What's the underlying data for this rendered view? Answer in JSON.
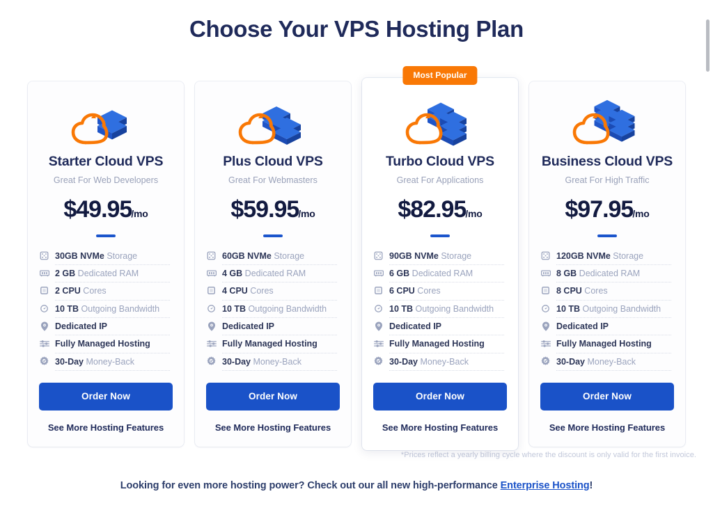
{
  "header": {
    "title": "Choose Your VPS Hosting Plan"
  },
  "colors": {
    "accent_blue": "#1a52c8",
    "badge_orange": "#f97805",
    "title_navy": "#1f2a5a",
    "muted_gray": "#9aa3bd"
  },
  "badge": {
    "label": "Most Popular"
  },
  "cta": {
    "order_label": "Order Now",
    "more_features_label": "See More Hosting Features"
  },
  "footnote": {
    "text": "*Prices reflect a yearly billing cycle where the discount is only valid for the first invoice."
  },
  "bottom_banner": {
    "text_before": "Looking for even more hosting power? Check out our all new high-performance ",
    "link_label": "Enterprise Hosting",
    "text_after": "!"
  },
  "plans": [
    {
      "name": "Starter Cloud VPS",
      "tagline": "Great For Web Developers",
      "price_amount": "$49.95",
      "price_period": "/mo",
      "featured": false,
      "icon": "cloud-server-single-icon",
      "icon_stacks": 1,
      "features": [
        {
          "icon": "storage-icon",
          "strong": "30GB NVMe",
          "light": " Storage",
          "underline": true
        },
        {
          "icon": "ram-icon",
          "strong": "2 GB",
          "light": " Dedicated RAM",
          "underline": true
        },
        {
          "icon": "cpu-icon",
          "strong": "2 CPU",
          "light": " Cores",
          "underline": true
        },
        {
          "icon": "gauge-icon",
          "strong": "10 TB",
          "light": " Outgoing Bandwidth",
          "underline": true
        },
        {
          "icon": "location-icon",
          "strong": "Dedicated IP",
          "light": "",
          "underline": true
        },
        {
          "icon": "sliders-icon",
          "strong": "Fully Managed Hosting",
          "light": "",
          "underline": true
        },
        {
          "icon": "shield-gear-icon",
          "strong": "30-Day",
          "light": " Money-Back",
          "underline": true
        }
      ]
    },
    {
      "name": "Plus Cloud VPS",
      "tagline": "Great For Webmasters",
      "price_amount": "$59.95",
      "price_period": "/mo",
      "featured": false,
      "icon": "cloud-server-double-icon",
      "icon_stacks": 2,
      "features": [
        {
          "icon": "storage-icon",
          "strong": "60GB NVMe",
          "light": " Storage",
          "underline": true
        },
        {
          "icon": "ram-icon",
          "strong": "4 GB",
          "light": " Dedicated RAM",
          "underline": true
        },
        {
          "icon": "cpu-icon",
          "strong": "4 CPU",
          "light": " Cores",
          "underline": true
        },
        {
          "icon": "gauge-icon",
          "strong": "10 TB",
          "light": " Outgoing Bandwidth",
          "underline": true
        },
        {
          "icon": "location-icon",
          "strong": "Dedicated IP",
          "light": "",
          "underline": true
        },
        {
          "icon": "sliders-icon",
          "strong": "Fully Managed Hosting",
          "light": "",
          "underline": true
        },
        {
          "icon": "shield-gear-icon",
          "strong": "30-Day",
          "light": " Money-Back",
          "underline": true
        }
      ]
    },
    {
      "name": "Turbo Cloud VPS",
      "tagline": "Great For Applications",
      "price_amount": "$82.95",
      "price_period": "/mo",
      "featured": true,
      "icon": "cloud-server-triple-icon",
      "icon_stacks": 3,
      "features": [
        {
          "icon": "storage-icon",
          "strong": "90GB NVMe",
          "light": " Storage",
          "underline": true
        },
        {
          "icon": "ram-icon",
          "strong": "6 GB",
          "light": " Dedicated RAM",
          "underline": true
        },
        {
          "icon": "cpu-icon",
          "strong": "6 CPU",
          "light": " Cores",
          "underline": true
        },
        {
          "icon": "gauge-icon",
          "strong": "10 TB",
          "light": " Outgoing Bandwidth",
          "underline": true
        },
        {
          "icon": "location-icon",
          "strong": "Dedicated IP",
          "light": "",
          "underline": true
        },
        {
          "icon": "sliders-icon",
          "strong": "Fully Managed Hosting",
          "light": "",
          "underline": true
        },
        {
          "icon": "shield-gear-icon",
          "strong": "30-Day",
          "light": " Money-Back",
          "underline": true
        }
      ]
    },
    {
      "name": "Business Cloud VPS",
      "tagline": "Great For High Traffic",
      "price_amount": "$97.95",
      "price_period": "/mo",
      "featured": false,
      "icon": "cloud-server-quad-icon",
      "icon_stacks": 4,
      "features": [
        {
          "icon": "storage-icon",
          "strong": "120GB NVMe",
          "light": " Storage",
          "underline": true
        },
        {
          "icon": "ram-icon",
          "strong": "8 GB",
          "light": " Dedicated RAM",
          "underline": true
        },
        {
          "icon": "cpu-icon",
          "strong": "8 CPU",
          "light": " Cores",
          "underline": true
        },
        {
          "icon": "gauge-icon",
          "strong": "10 TB",
          "light": " Outgoing Bandwidth",
          "underline": true
        },
        {
          "icon": "location-icon",
          "strong": "Dedicated IP",
          "light": "",
          "underline": true
        },
        {
          "icon": "sliders-icon",
          "strong": "Fully Managed Hosting",
          "light": "",
          "underline": true
        },
        {
          "icon": "shield-gear-icon",
          "strong": "30-Day",
          "light": " Money-Back",
          "underline": true
        }
      ]
    }
  ]
}
